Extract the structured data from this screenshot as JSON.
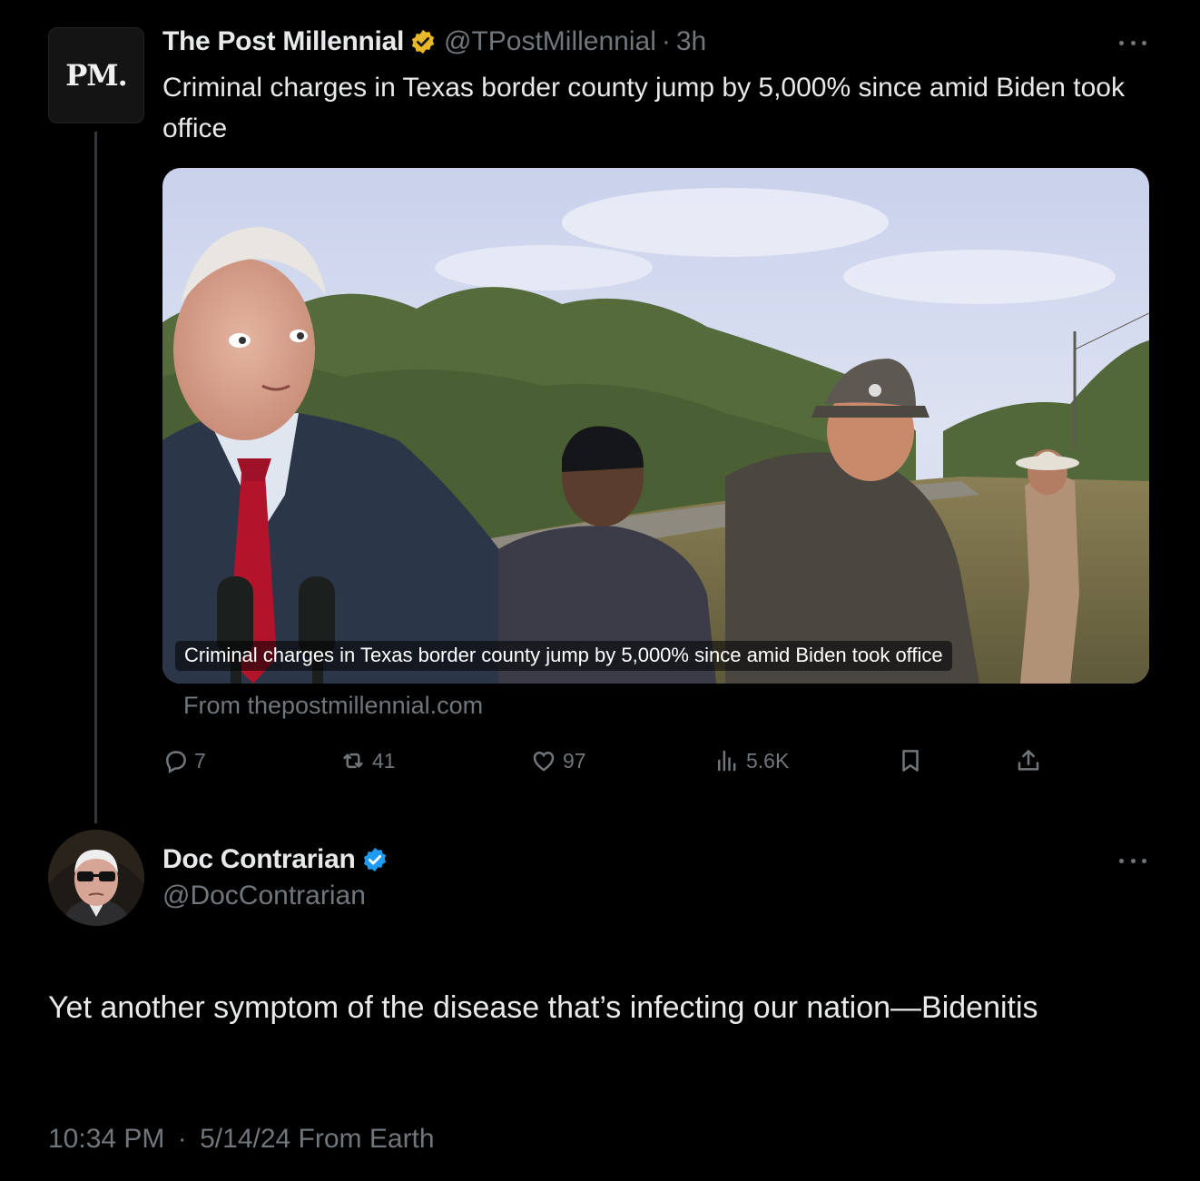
{
  "parent_tweet": {
    "avatar_text": "PM.",
    "author_name": "The Post Millennial",
    "author_handle": "@TPostMillennial",
    "separator": "·",
    "time_ago": "3h",
    "text": "Criminal charges in Texas border county jump by 5,000% since amid Biden took office",
    "media_caption": "Criminal charges in Texas border county jump by 5,000% since amid Biden took office",
    "link_source": "From thepostmillennial.com",
    "badge_color": "#e8b829",
    "actions": {
      "replies": "7",
      "reposts": "41",
      "likes": "97",
      "views": "5.6K"
    },
    "icons": [
      "reply-icon",
      "repost-icon",
      "like-icon",
      "views-icon",
      "bookmark-icon",
      "share-icon",
      "more-icon"
    ]
  },
  "reply_tweet": {
    "author_name": "Doc Contrarian",
    "author_handle": "@DocContrarian",
    "badge_color": "#1d9bf0",
    "text": "Yet another symptom of the disease that’s infecting our nation—Bidenitis",
    "time": "10:34 PM",
    "separator": "·",
    "date": "5/14/24",
    "source": "From Earth"
  }
}
